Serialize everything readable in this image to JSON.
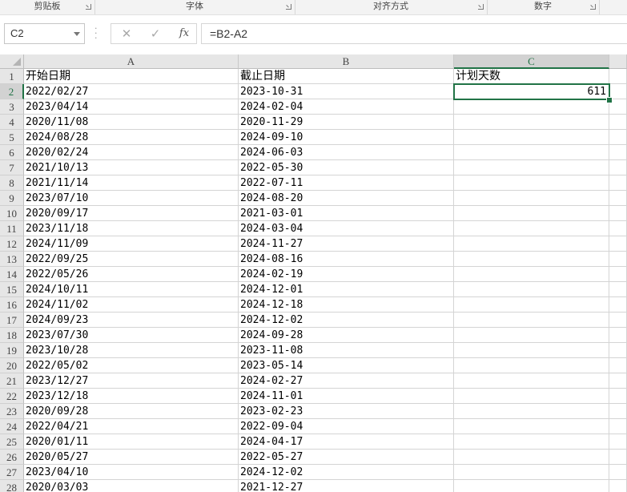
{
  "ribbon": {
    "groups": [
      "剪贴板",
      "字体",
      "对齐方式",
      "数字"
    ]
  },
  "formula_bar": {
    "name_box": "C2",
    "cancel_icon": "✕",
    "enter_icon": "✓",
    "fx_label": "fx",
    "formula": "=B2-A2"
  },
  "columns": [
    "A",
    "B",
    "C"
  ],
  "selected_cell": "C2",
  "rows": [
    {
      "n": "1",
      "a": "开始日期",
      "b": "截止日期",
      "c": "计划天数"
    },
    {
      "n": "2",
      "a": "2022/02/27",
      "b": "2023-10-31",
      "c": "611"
    },
    {
      "n": "3",
      "a": "2023/04/14",
      "b": "2024-02-04",
      "c": ""
    },
    {
      "n": "4",
      "a": "2020/11/08",
      "b": "2020-11-29",
      "c": ""
    },
    {
      "n": "5",
      "a": "2024/08/28",
      "b": "2024-09-10",
      "c": ""
    },
    {
      "n": "6",
      "a": "2020/02/24",
      "b": "2024-06-03",
      "c": ""
    },
    {
      "n": "7",
      "a": "2021/10/13",
      "b": "2022-05-30",
      "c": ""
    },
    {
      "n": "8",
      "a": "2021/11/14",
      "b": "2022-07-11",
      "c": ""
    },
    {
      "n": "9",
      "a": "2023/07/10",
      "b": "2024-08-20",
      "c": ""
    },
    {
      "n": "10",
      "a": "2020/09/17",
      "b": "2021-03-01",
      "c": ""
    },
    {
      "n": "11",
      "a": "2023/11/18",
      "b": "2024-03-04",
      "c": ""
    },
    {
      "n": "12",
      "a": "2024/11/09",
      "b": "2024-11-27",
      "c": ""
    },
    {
      "n": "13",
      "a": "2022/09/25",
      "b": "2024-08-16",
      "c": ""
    },
    {
      "n": "14",
      "a": "2022/05/26",
      "b": "2024-02-19",
      "c": ""
    },
    {
      "n": "15",
      "a": "2024/10/11",
      "b": "2024-12-01",
      "c": ""
    },
    {
      "n": "16",
      "a": "2024/11/02",
      "b": "2024-12-18",
      "c": ""
    },
    {
      "n": "17",
      "a": "2024/09/23",
      "b": "2024-12-02",
      "c": ""
    },
    {
      "n": "18",
      "a": "2023/07/30",
      "b": "2024-09-28",
      "c": ""
    },
    {
      "n": "19",
      "a": "2023/10/28",
      "b": "2023-11-08",
      "c": ""
    },
    {
      "n": "20",
      "a": "2022/05/02",
      "b": "2023-05-14",
      "c": ""
    },
    {
      "n": "21",
      "a": "2023/12/27",
      "b": "2024-02-27",
      "c": ""
    },
    {
      "n": "22",
      "a": "2023/12/18",
      "b": "2024-11-01",
      "c": ""
    },
    {
      "n": "23",
      "a": "2020/09/28",
      "b": "2023-02-23",
      "c": ""
    },
    {
      "n": "24",
      "a": "2022/04/21",
      "b": "2022-09-04",
      "c": ""
    },
    {
      "n": "25",
      "a": "2020/01/11",
      "b": "2024-04-17",
      "c": ""
    },
    {
      "n": "26",
      "a": "2020/05/27",
      "b": "2022-05-27",
      "c": ""
    },
    {
      "n": "27",
      "a": "2023/04/10",
      "b": "2024-12-02",
      "c": ""
    },
    {
      "n": "28",
      "a": "2020/03/03",
      "b": "2021-12-27",
      "c": ""
    }
  ],
  "colors": {
    "accent": "#217346",
    "header_bg": "#e6e6e6",
    "gridline": "#d4d4d4"
  }
}
